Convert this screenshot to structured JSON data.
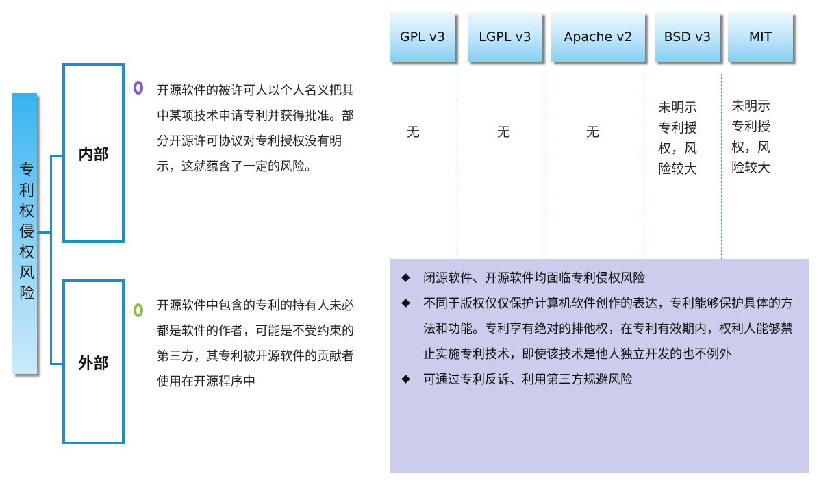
{
  "title": "专利权侵权风险",
  "categories": [
    {
      "label": "内部",
      "ring_color": "#8a56cc",
      "text": "开源软件的被许可人以个人名义把其中某项技术申请专利并获得批准。部分开源许可协议对专利授权没有明示，这就蕴含了一定的风险。"
    },
    {
      "label": "外部",
      "ring_color": "#8fbf4a",
      "text": "开源软件中包含的专利的持有人未必都是软件的作者，可能是不受约束的第三方，其专利被开源软件的贡献者使用在开源程序中"
    }
  ],
  "licenses": [
    {
      "name": "GPL v3",
      "value": "无"
    },
    {
      "name": "LGPL v3",
      "value": "无"
    },
    {
      "name": "Apache v2",
      "value": "无"
    },
    {
      "name": "BSD v3",
      "value": "未明示专利授权，风险较大"
    },
    {
      "name": "MIT",
      "value": "未明示专利授权，风险较大"
    }
  ],
  "summary": [
    "闭源软件、开源软件均面临专利侵权风险",
    "不同于版权仅仅保护计算机软件创作的表达，专利能够保护具体的方法和功能。专利享有绝对的排他权，在专利有效期内，权利人能够禁止实施专利技术，即使该技术是他人独立开发的也不例外",
    "可通过专利反诉、利用第三方规避风险"
  ]
}
